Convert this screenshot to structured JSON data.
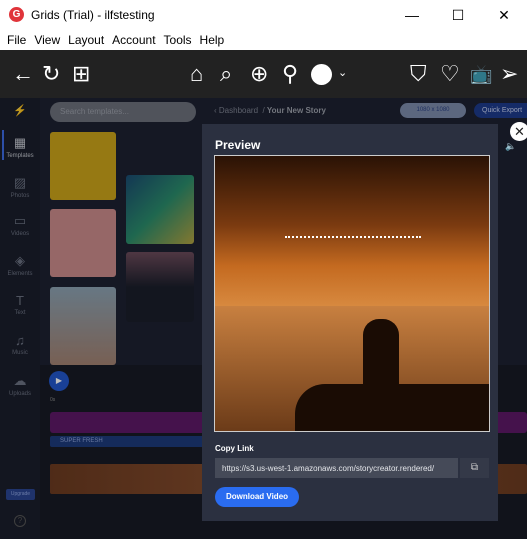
{
  "window": {
    "title": "Grids (Trial) - ilfstesting",
    "logo_letter": "G",
    "minimize": "—",
    "maximize": "☐",
    "close": "✕"
  },
  "menu": [
    "File",
    "View",
    "Layout",
    "Account",
    "Tools",
    "Help"
  ],
  "toolbar": {
    "back": "←",
    "refresh": "↻",
    "grid": "⊞",
    "home": "⌂",
    "search": "⌕",
    "add": "⊕",
    "location": "⚲",
    "bookmark": "⛉",
    "heart": "♡",
    "tv": "📺",
    "send": "➢"
  },
  "rail": [
    {
      "label": "Templates",
      "icon": "▦"
    },
    {
      "label": "Photos",
      "icon": "▨"
    },
    {
      "label": "Videos",
      "icon": "▭"
    },
    {
      "label": "Elements",
      "icon": "◈"
    },
    {
      "label": "Text",
      "icon": "T"
    },
    {
      "label": "Music",
      "icon": "♫"
    },
    {
      "label": "Uploads",
      "icon": "☁"
    }
  ],
  "search": {
    "placeholder": "Search templates..."
  },
  "breadcrumb": {
    "parent": "Dashboard",
    "current": "Your New Story"
  },
  "size_button": "1080 x 1080",
  "export_button": "Quick Export",
  "timeline": {
    "start": "0s",
    "text_track": "SUPER FRESH"
  },
  "upgrade": "Upgrade",
  "help": "?",
  "modal": {
    "title": "Preview",
    "copy_link_label": "Copy Link",
    "link": "https://s3.us-west-1.amazonaws.com/storycreator.rendered/",
    "download": "Download Video"
  }
}
